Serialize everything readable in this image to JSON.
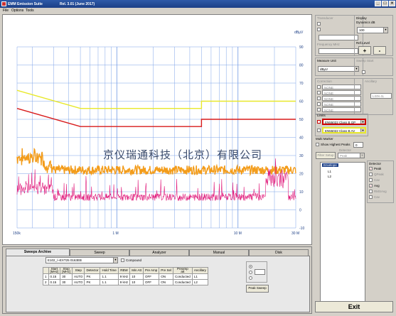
{
  "window": {
    "title": "EMM Emission Suite",
    "version": "Rel. 3.01 (June 2017)",
    "menu": [
      "File",
      "Options",
      "Tools"
    ],
    "watermark": "京仪瑞通科技（北京）有限公司"
  },
  "plot": {
    "yunit": "dBµV",
    "yticks": [
      "90",
      "80",
      "70",
      "60",
      "50",
      "40",
      "30",
      "20",
      "10",
      "0",
      "-10"
    ],
    "xticks": [
      "150k",
      "1 M",
      "10 M",
      "30 M"
    ],
    "colors": {
      "limit_qp": "#d81b1b",
      "limit_avg": "#e8e82a",
      "peak": "#f39c1a",
      "avg": "#e0187a",
      "grid": "#7fa4e8"
    }
  },
  "chart_data": {
    "type": "line",
    "xlabel": "",
    "ylabel": "dBµV",
    "ylim": [
      -10,
      90
    ],
    "xlim": [
      0.15,
      30
    ],
    "xscale": "log",
    "series": [
      {
        "x": [
          0.15,
          0.5,
          0.5,
          5,
          5,
          30
        ],
        "y": [
          66,
          56,
          56,
          56,
          60,
          60
        ]
      },
      {
        "x": [
          0.15,
          0.5,
          0.5,
          5,
          5,
          30
        ],
        "y": [
          56,
          46,
          46,
          46,
          50,
          50
        ]
      },
      {
        "x": [
          0.15,
          1,
          5,
          15,
          30
        ],
        "y": [
          24,
          22,
          22,
          21,
          21
        ]
      },
      {
        "x": [
          0.15,
          1,
          5,
          15,
          22,
          30
        ],
        "y": [
          8,
          7,
          6,
          9,
          18,
          8
        ]
      }
    ]
  },
  "tabs": [
    {
      "label": "Sweeps Archive",
      "active": true
    },
    {
      "label": "Sweep",
      "active": false
    },
    {
      "label": "Analyzer",
      "active": false
    },
    {
      "label": "Manual",
      "active": false
    },
    {
      "label": "Disk",
      "active": false
    }
  ],
  "sweeps": {
    "file": "E102_/~EXT25 0163EB",
    "compound_label": "Compound",
    "columns": [
      "",
      "Start\n[MHz]",
      "Stop\n[MHz]",
      "Step",
      "Detector",
      "Hold Time",
      "RBW",
      "Min Att",
      "Pre Amp",
      "Pre Sel",
      "Preamp\natt",
      "Ancillary"
    ],
    "rows": [
      [
        "1",
        "0.15",
        "30",
        "AUTO",
        "PK",
        "1.1",
        "9 kHz",
        "10",
        "OFF",
        "ON",
        "Conducted",
        "L1"
      ],
      [
        "2",
        "0.15",
        "30",
        "AUTO",
        "PK",
        "1.1",
        "9 kHz",
        "10",
        "OFF",
        "ON",
        "Conducted",
        "L2"
      ]
    ],
    "peak_sweep_label": "Peak Sweep"
  },
  "panel": {
    "transducer_label": "Transducer",
    "display_label": "Display",
    "dynamics_label": "Dynamics dB",
    "dynamics_value": "100",
    "ref_level_label": "Ref.Level",
    "ref_plus": "+",
    "ref_minus": "-",
    "frequency_label": "Frequency MHz",
    "measure_unit_label": "Measure Unit",
    "measure_unit_value": "dBµV",
    "sweep_label": "Sweep Start",
    "correction_label": "Correction",
    "none_items": [
      "NONE",
      "NONE",
      "NONE",
      "NONE",
      "NONE"
    ],
    "ancillary_label": "Ancillary",
    "ancillary_value": "LISN 4L",
    "limits_label": "Limits",
    "limit1": "EN55022 Class B QP",
    "limit2": "EN55022 Class B AV",
    "multi_marker_label": "Multi Marker",
    "show_highest_label": "Show Highest Peaks",
    "show_highest_value": "0",
    "filter_label": "Filter Setup",
    "detector_combo_label": "Detector",
    "detector_combo_value": "Peak",
    "envelope_label": "Envelope",
    "tree_items": [
      "L1",
      "L2"
    ],
    "detector_group": "Detector",
    "detectors": [
      "Peak",
      "QPeak",
      "Cav",
      "Avg",
      "RMSAvg",
      "Cav"
    ],
    "exit_label": "Exit"
  }
}
